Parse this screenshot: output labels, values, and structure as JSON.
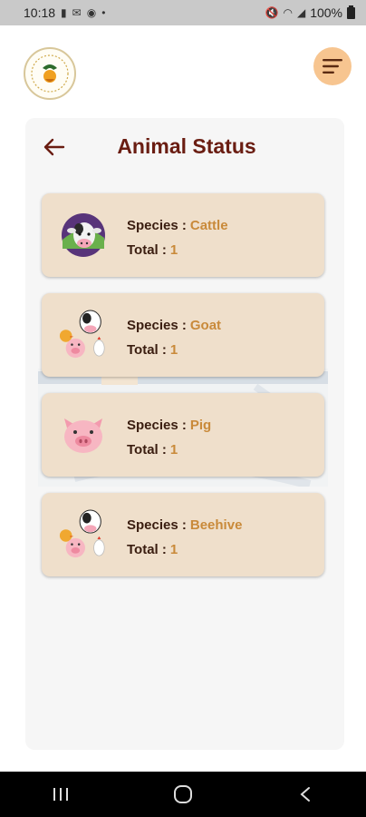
{
  "status": {
    "time": "10:18",
    "battery": "100%",
    "icons_left": [
      "gmail-icon",
      "mail-icon",
      "record-icon"
    ],
    "icons_right": [
      "mute-icon",
      "wifi-icon",
      "signal-icon",
      "battery-icon"
    ]
  },
  "header": {
    "logo": "app-logo",
    "menu_icon": "menu-icon"
  },
  "page": {
    "title": "Animal Status",
    "back_icon": "back-arrow-icon"
  },
  "labels": {
    "species": "Species :",
    "total": "Total :"
  },
  "cards": [
    {
      "species": "Cattle",
      "total": "1",
      "icon": "cattle-icon"
    },
    {
      "species": "Goat",
      "total": "1",
      "icon": "farm-animals-icon"
    },
    {
      "species": "Pig",
      "total": "1",
      "icon": "pig-icon"
    },
    {
      "species": "Beehive",
      "total": "1",
      "icon": "farm-animals-icon"
    }
  ],
  "colors": {
    "title": "#6a1d12",
    "value": "#c98a3a",
    "card_bg": "#efdfcb",
    "menu_bg": "#f7c590"
  },
  "navbar": {
    "icons": [
      "recent-apps-icon",
      "home-icon",
      "back-icon"
    ]
  }
}
